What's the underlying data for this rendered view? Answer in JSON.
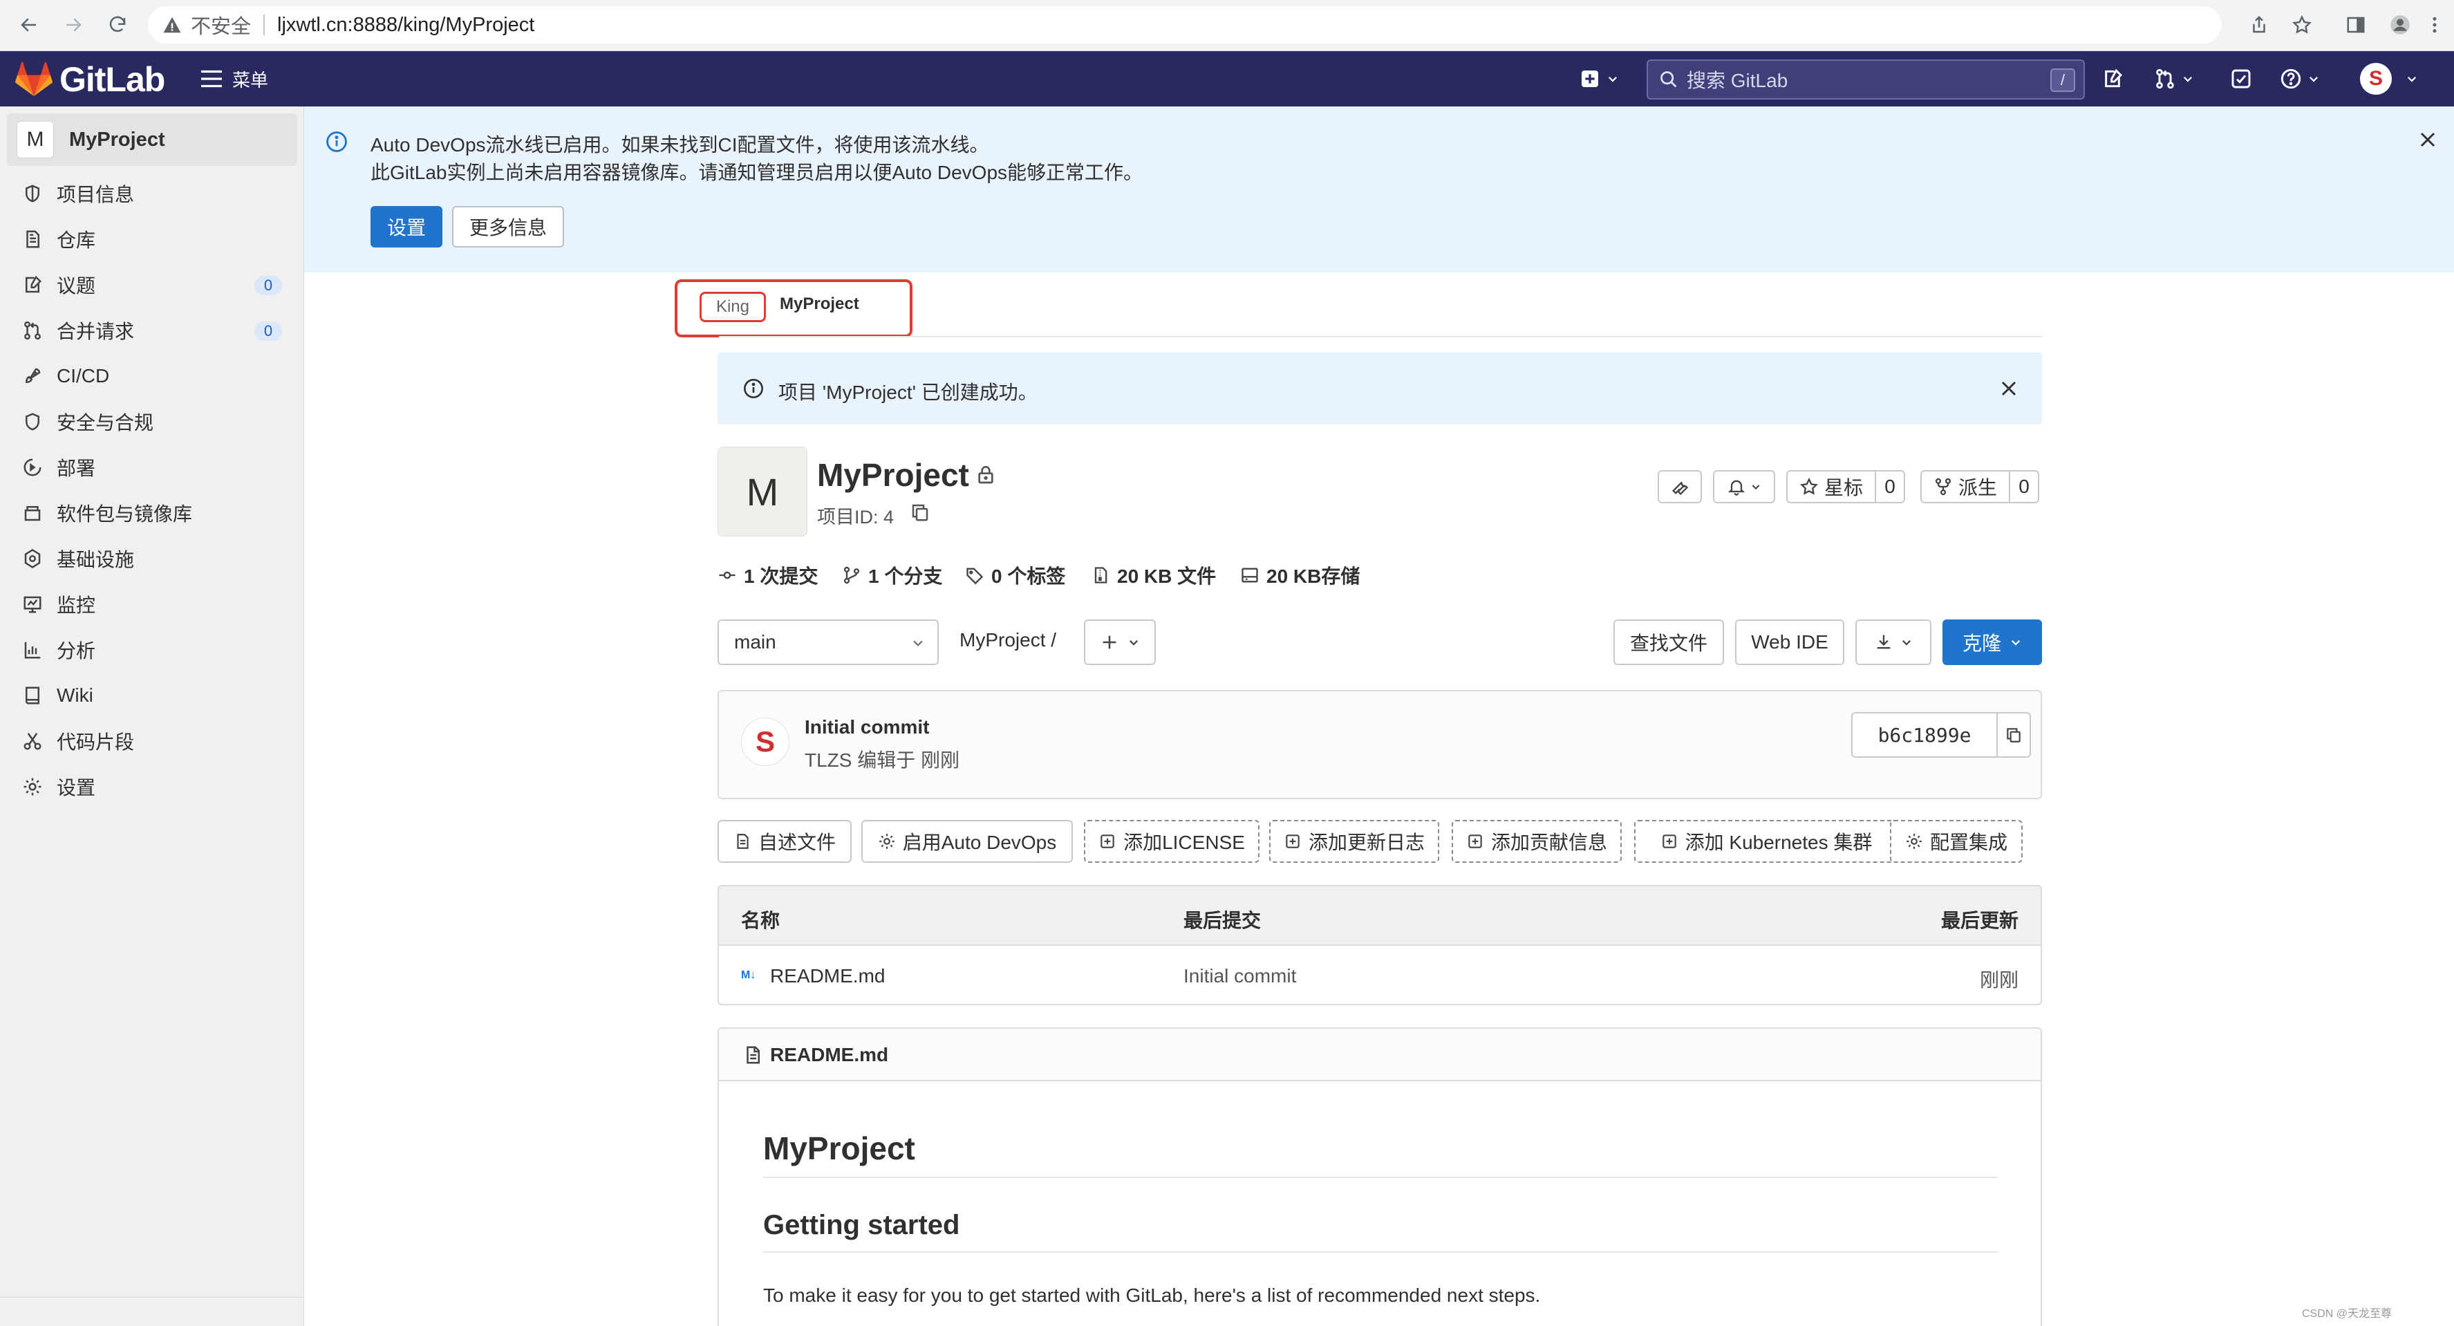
{
  "browser": {
    "security_label": "不安全",
    "url": "ljxwtl.cn:8888/king/MyProject"
  },
  "header": {
    "brand": "GitLab",
    "menu_label": "菜单",
    "search_placeholder": "搜索 GitLab",
    "search_shortcut": "/",
    "avatar_letter": "S",
    "color": "#292961"
  },
  "sidebar": {
    "project_avatar": "M",
    "project_name": "MyProject",
    "items": [
      {
        "label": "项目信息",
        "icon": "project-icon"
      },
      {
        "label": "仓库",
        "icon": "doc-icon"
      },
      {
        "label": "议题",
        "icon": "issues-icon",
        "badge": "0"
      },
      {
        "label": "合并请求",
        "icon": "merge-request-icon",
        "badge": "0"
      },
      {
        "label": "CI/CD",
        "icon": "rocket-icon"
      },
      {
        "label": "安全与合规",
        "icon": "shield-icon"
      },
      {
        "label": "部署",
        "icon": "deploy-icon"
      },
      {
        "label": "软件包与镜像库",
        "icon": "package-icon"
      },
      {
        "label": "基础设施",
        "icon": "cloud-gear-icon"
      },
      {
        "label": "监控",
        "icon": "monitor-icon"
      },
      {
        "label": "分析",
        "icon": "chart-icon"
      },
      {
        "label": "Wiki",
        "icon": "book-icon"
      },
      {
        "label": "代码片段",
        "icon": "snippet-icon"
      },
      {
        "label": "设置",
        "icon": "gear-icon"
      }
    ]
  },
  "banner": {
    "line1": "Auto DevOps流水线已启用。如果未找到CI配置文件，将使用该流水线。",
    "line2": "此GitLab实例上尚未启用容器镜像库。请通知管理员启用以便Auto DevOps能够正常工作。",
    "settings_button": "设置",
    "more_info_button": "更多信息"
  },
  "breadcrumb": {
    "parent": "King",
    "current": "MyProject"
  },
  "success_message": "项目 'MyProject' 已创建成功。",
  "project": {
    "avatar": "M",
    "name": "MyProject",
    "id_label": "项目ID: 4",
    "star_label": "星标",
    "star_count": "0",
    "fork_label": "派生",
    "fork_count": "0"
  },
  "stats": {
    "commits": "1 次提交",
    "branches": "1 个分支",
    "tags": "0 个标签",
    "files": "20 KB 文件",
    "storage": "20 KB存储"
  },
  "toolbar": {
    "branch": "main",
    "path": "MyProject",
    "path_sep": "/",
    "find_file": "查找文件",
    "web_ide": "Web IDE",
    "clone": "克隆"
  },
  "last_commit": {
    "title": "Initial commit",
    "meta": "TLZS 编辑于 刚刚",
    "sha": "b6c1899e",
    "avatar_letter": "S"
  },
  "quick_actions": [
    {
      "label": "自述文件",
      "style": "solid"
    },
    {
      "label": "启用Auto DevOps",
      "style": "solid"
    },
    {
      "label": "添加LICENSE",
      "style": "dashed"
    },
    {
      "label": "添加更新日志",
      "style": "dashed"
    },
    {
      "label": "添加贡献信息",
      "style": "dashed"
    },
    {
      "label": "添加 Kubernetes 集群",
      "style": "dashed"
    },
    {
      "label": "配置集成",
      "style": "dashed"
    }
  ],
  "file_table": {
    "headers": {
      "name": "名称",
      "last_commit": "最后提交",
      "last_update": "最后更新"
    },
    "rows": [
      {
        "icon_text": "M↓",
        "name": "README.md",
        "commit": "Initial commit",
        "updated": "刚刚"
      }
    ]
  },
  "readme": {
    "file_name": "README.md",
    "h1": "MyProject",
    "h2": "Getting started",
    "paragraph": "To make it easy for you to get started with GitLab, here's a list of recommended next steps."
  },
  "watermark": "CSDN @天龙至尊"
}
